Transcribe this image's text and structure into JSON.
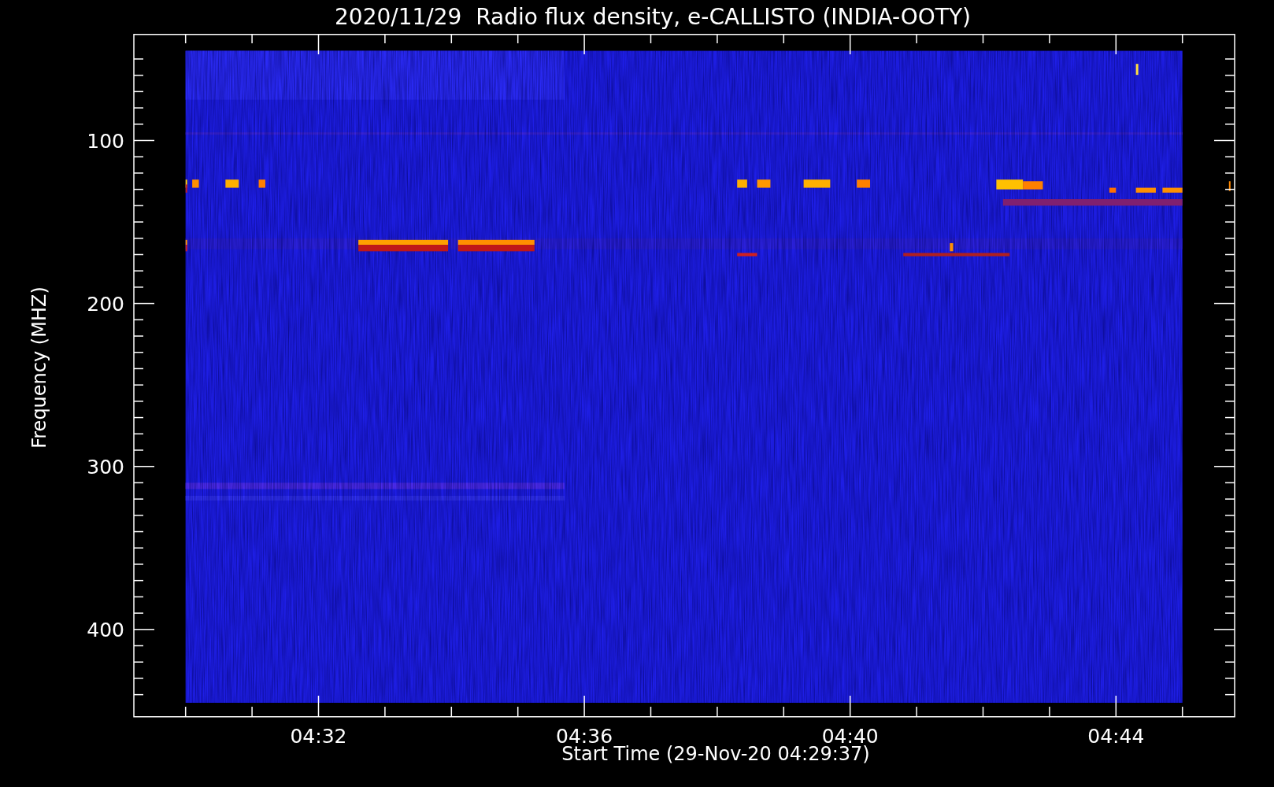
{
  "title": "2020/11/29  Radio flux density, e-CALLISTO (INDIA-OOTY)",
  "y_axis": {
    "label": "Frequency (MHZ)",
    "ticks": [
      "100",
      "200",
      "300",
      "400"
    ]
  },
  "x_axis": {
    "label": "Start Time (29-Nov-20 04:29:37)",
    "ticks": [
      "04:32",
      "04:36",
      "04:40",
      "04:44"
    ]
  }
}
